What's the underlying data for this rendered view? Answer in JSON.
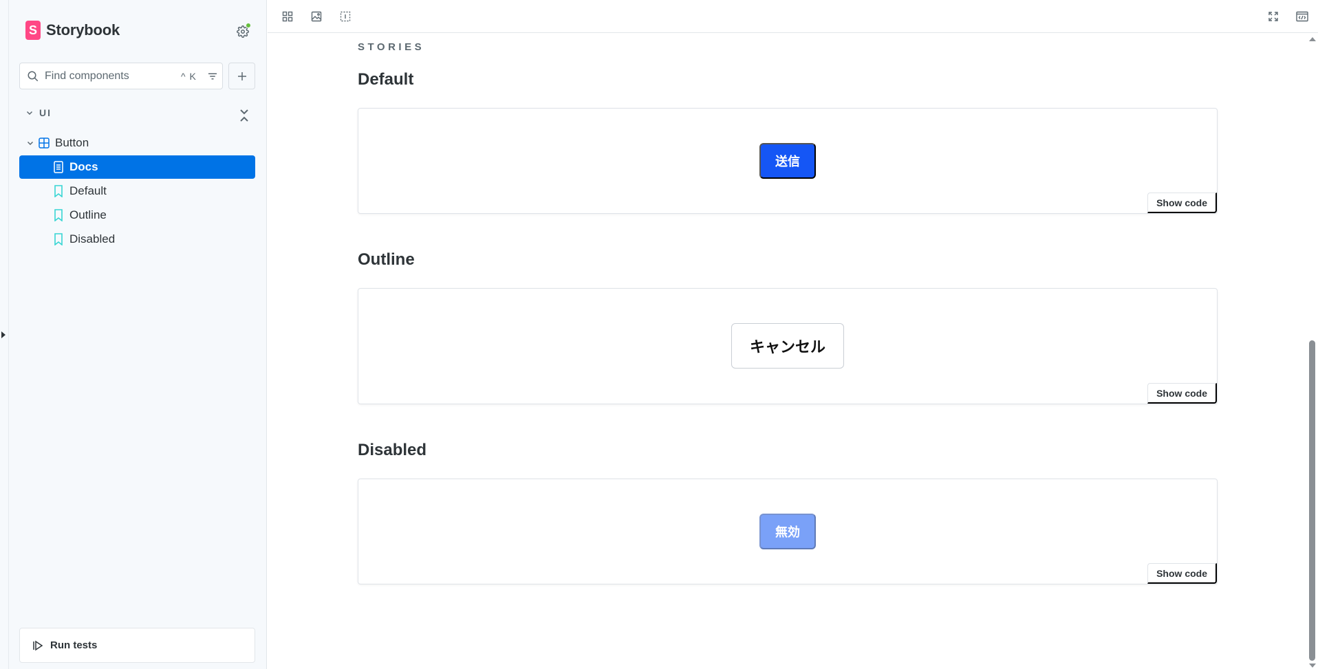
{
  "sidebar": {
    "brand": {
      "logo_letter": "S",
      "name": "Storybook"
    },
    "search": {
      "placeholder": "Find components",
      "shortcut": "^ K"
    },
    "group": {
      "label": "UI"
    },
    "component": {
      "label": "Button"
    },
    "items": [
      {
        "label": "Docs",
        "icon": "document-icon",
        "selected": true
      },
      {
        "label": "Default",
        "icon": "bookmark-icon"
      },
      {
        "label": "Outline",
        "icon": "bookmark-icon"
      },
      {
        "label": "Disabled",
        "icon": "bookmark-icon"
      }
    ],
    "run_tests": {
      "label": "Run tests"
    }
  },
  "toolbar": {
    "left_icons": [
      "grid-icon",
      "image-icon",
      "outline-icon"
    ],
    "right_icons": [
      "fullscreen-icon",
      "share-code-icon"
    ]
  },
  "docs": {
    "section_label": "STORIES",
    "stories": [
      {
        "title": "Default",
        "button_label": "送信",
        "variant": "primary",
        "show_code": "Show code"
      },
      {
        "title": "Outline",
        "button_label": "キャンセル",
        "variant": "outline",
        "show_code": "Show code"
      },
      {
        "title": "Disabled",
        "button_label": "無効",
        "variant": "disabled",
        "show_code": "Show code"
      }
    ]
  },
  "colors": {
    "accent": "#0073e6",
    "brand": "#ff4785",
    "primary_button": "#1556f5",
    "disabled_button": "#7aa1f8",
    "status_dot": "#66bf3c",
    "bookmark": "#37d5d3"
  }
}
